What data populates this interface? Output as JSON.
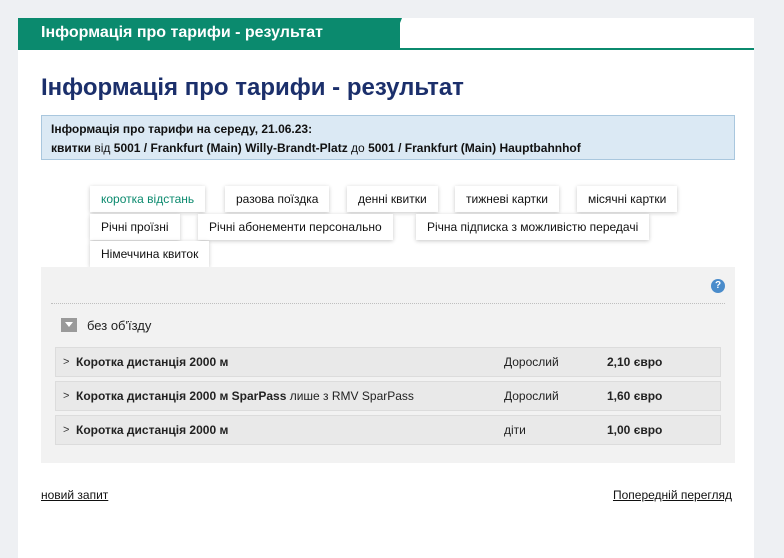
{
  "header": {
    "tab_title": "Інформація про тарифи - результат"
  },
  "page_title": "Інформація про тарифи - результат",
  "info": {
    "line1": "Інформація про тарифи на середу, 21.06.23:",
    "tickets_word": "квитки",
    "from_word": "від",
    "from_station": "5001 / Frankfurt (Main) Willy-Brandt-Platz",
    "to_word": "до",
    "to_station": "5001 / Frankfurt (Main) Hauptbahnhof"
  },
  "tabs": [
    {
      "label": "коротка відстань",
      "active": true
    },
    {
      "label": "разова поїздка"
    },
    {
      "label": "денні квитки"
    },
    {
      "label": "тижневі картки"
    },
    {
      "label": "місячні картки"
    },
    {
      "label": "Річні проїзні"
    },
    {
      "label": "Річні абонементи персонально"
    },
    {
      "label": "Річна підписка з можливістю передачі"
    },
    {
      "label": "Німеччина квиток"
    }
  ],
  "panel": {
    "help_icon": "?",
    "group_label": "без об'їзду",
    "rows": [
      {
        "name": "Коротка дистанція 2000 м",
        "extra": "",
        "passenger": "Дорослий",
        "price": "2,10 євро"
      },
      {
        "name": "Коротка дистанція 2000 м SparPass",
        "extra": "лише з RMV SparPass",
        "passenger": "Дорослий",
        "price": "1,60 євро"
      },
      {
        "name": "Коротка дистанція 2000 м",
        "extra": "",
        "passenger": "діти",
        "price": "1,00 євро"
      }
    ]
  },
  "footer": {
    "new_request": "новий запит",
    "previous_view": "Попередній перегляд"
  },
  "colors": {
    "brand": "#0b8a6e",
    "title": "#1b2f6b",
    "info_bg": "#dbe9f4"
  }
}
